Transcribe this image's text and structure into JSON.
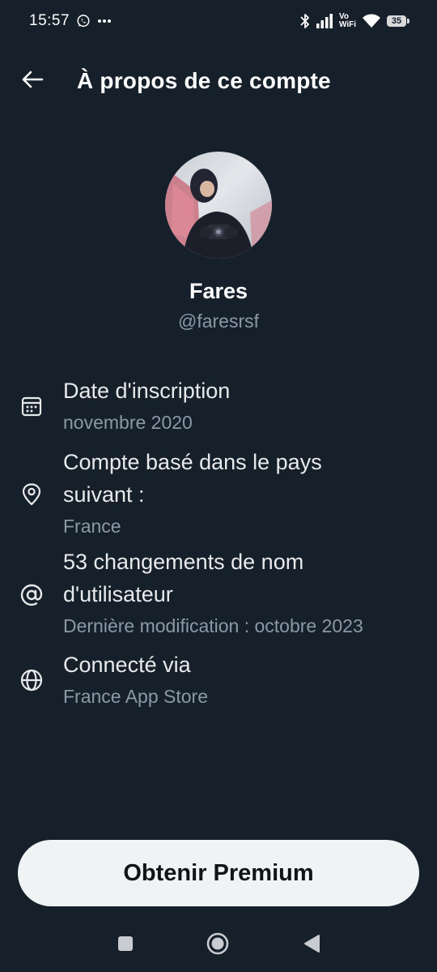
{
  "status_bar": {
    "time": "15:57",
    "vowifi_top": "Vo",
    "vowifi_bottom": "WiFi",
    "battery": "35",
    "icons": [
      "whatsapp-icon",
      "more-dots-icon",
      "bluetooth-icon",
      "signal-icon",
      "wifi-icon",
      "battery-icon"
    ]
  },
  "header": {
    "title": "À propos de ce compte",
    "back_icon": "arrow-left-icon"
  },
  "profile": {
    "name": "Fares",
    "handle": "@faresrsf"
  },
  "info": [
    {
      "icon": "calendar-icon",
      "title": "Date d'inscription",
      "subtitle": "novembre 2020"
    },
    {
      "icon": "location-pin-icon",
      "title_line1": "Compte basé dans le pays",
      "title_line2": "suivant :",
      "subtitle": "France"
    },
    {
      "icon": "at-sign-icon",
      "title_line1": "53 changements de nom",
      "title_line2": "d'utilisateur",
      "subtitle": "Dernière modification : octobre 2023"
    },
    {
      "icon": "globe-icon",
      "title": "Connecté via",
      "subtitle": "France App Store"
    }
  ],
  "premium_button": {
    "label": "Obtenir Premium"
  },
  "nav_bar": {
    "icons": [
      "recents-square-icon",
      "home-circle-icon",
      "back-triangle-icon"
    ]
  },
  "colors": {
    "background": "#15202b",
    "primary_text": "#e7e9ea",
    "secondary_text": "#8b98a5",
    "button_bg": "#eff3f4",
    "button_text": "#0f1419"
  }
}
